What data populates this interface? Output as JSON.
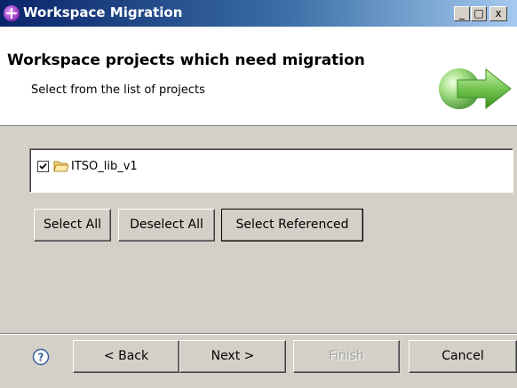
{
  "window": {
    "title": "Workspace Migration",
    "buttons": {
      "minimize": "_",
      "maximize": "□",
      "close": "x"
    }
  },
  "header": {
    "title": "Workspace projects which need migration",
    "subtitle": "Select from the list of projects",
    "graphic_icon": "green-arrow-icon"
  },
  "project_list": {
    "items": [
      {
        "label": "ITSO_lib_v1",
        "checked": true,
        "icon": "folder-icon"
      }
    ]
  },
  "selection_buttons": {
    "select_all": "Select All",
    "deselect_all": "Deselect All",
    "select_referenced": "Select Referenced"
  },
  "footer": {
    "help_icon": "help-icon",
    "back": "< Back",
    "next": "Next >",
    "finish": "Finish",
    "cancel": "Cancel"
  },
  "colors": {
    "titlebar_start": "#0a246a",
    "titlebar_end": "#a6caf0",
    "dialog_bg": "#d4d0c8",
    "header_bg": "#ffffff",
    "arrow_green": "#6cc04a"
  }
}
